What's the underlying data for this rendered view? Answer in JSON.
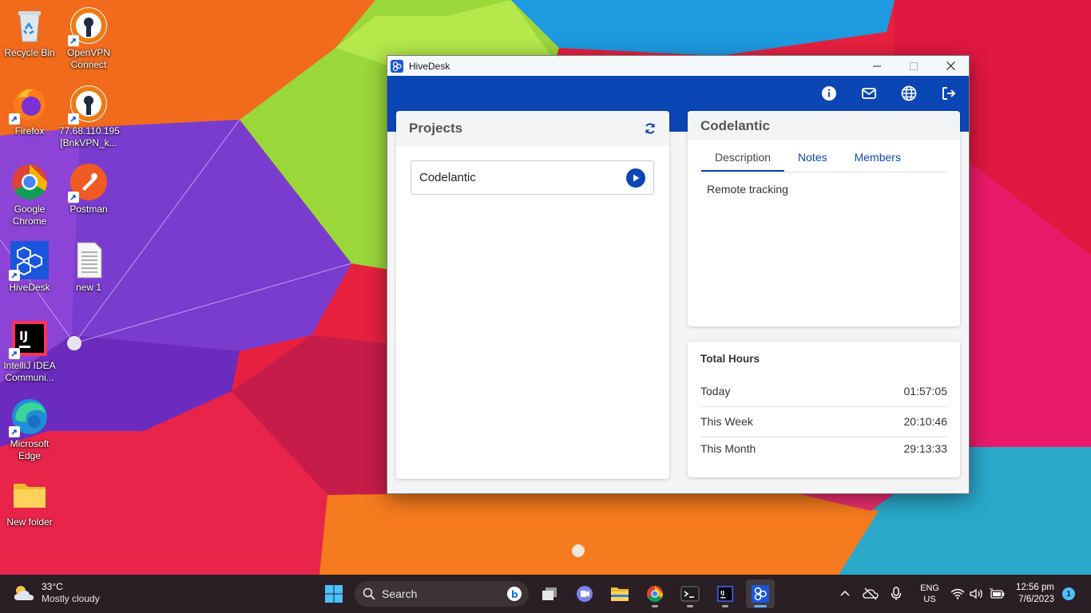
{
  "desktop": {
    "icons": [
      {
        "label": "Recycle Bin",
        "icon": "recycle-bin-icon"
      },
      {
        "label": "OpenVPN Connect",
        "icon": "openvpn-icon"
      },
      {
        "label": "Firefox",
        "icon": "firefox-icon"
      },
      {
        "label": "77.68.110.195 [BnkVPN_k...",
        "icon": "openvpn-icon"
      },
      {
        "label": "Google Chrome",
        "icon": "chrome-icon"
      },
      {
        "label": "Postman",
        "icon": "postman-icon"
      },
      {
        "label": "HiveDesk",
        "icon": "hivedesk-icon"
      },
      {
        "label": "new 1",
        "icon": "text-file-icon"
      },
      {
        "label": "IntelliJ IDEA Communi...",
        "icon": "intellij-icon"
      },
      {
        "label": "Microsoft Edge",
        "icon": "edge-icon"
      },
      {
        "label": "New folder",
        "icon": "folder-icon"
      }
    ]
  },
  "window": {
    "title": "HiveDesk",
    "topbar_icons": [
      "info-icon",
      "mail-icon",
      "globe-icon",
      "logout-icon"
    ]
  },
  "projects": {
    "header": "Projects",
    "items": [
      {
        "name": "Codelantic"
      }
    ]
  },
  "detail": {
    "title": "Codelantic",
    "tabs": [
      {
        "label": "Description",
        "active": true
      },
      {
        "label": "Notes",
        "active": false
      },
      {
        "label": "Members",
        "active": false
      }
    ],
    "description": "Remote tracking"
  },
  "hours": {
    "title": "Total Hours",
    "rows": [
      {
        "label": "Today",
        "value": "01:57:05"
      },
      {
        "label": "This Week",
        "value": "20:10:46"
      },
      {
        "label": "This Month",
        "value": "29:13:33"
      }
    ]
  },
  "taskbar": {
    "weather_temp": "33°C",
    "weather_cond": "Mostly cloudy",
    "search_placeholder": "Search",
    "lang_1": "ENG",
    "lang_2": "US",
    "time": "12:56 pm",
    "date": "7/6/2023",
    "notifications": "1"
  },
  "colors": {
    "accent": "#0a46b4",
    "taskbar": "#2a1f24"
  }
}
